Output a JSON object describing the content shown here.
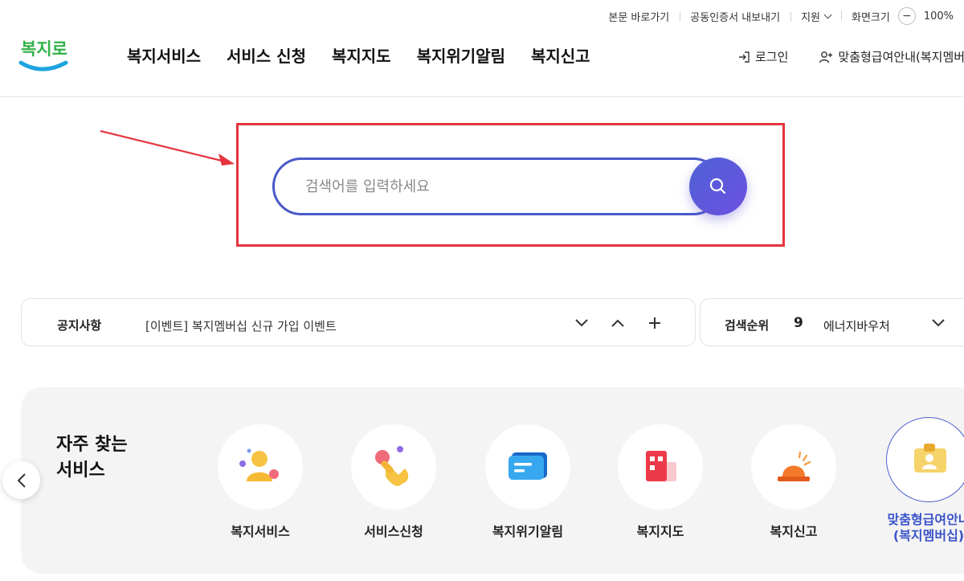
{
  "utility_bar": {
    "skip_to_content": "본문 바로가기",
    "certificate_export": "공동인증서 내보내기",
    "support": "지원",
    "zoom_label": "화면크기",
    "zoom_minus": "−",
    "zoom_value": "100%"
  },
  "logo": {
    "text": "복지로"
  },
  "nav": {
    "items": [
      "복지서비스",
      "서비스 신청",
      "복지지도",
      "복지위기알림",
      "복지신고"
    ]
  },
  "header_right": {
    "login": "로그인",
    "membership": "맞춤형급여안내(복지멤버십)"
  },
  "search": {
    "placeholder": "검색어를 입력하세요",
    "value": ""
  },
  "notice": {
    "label": "공지사항",
    "text": "[이벤트] 복지멤버십 신규 가입 이벤트"
  },
  "ranking": {
    "label": "검색순위",
    "rank": "9",
    "keyword": "에너지바우처"
  },
  "frequent": {
    "title": "자주 찾는\n서비스",
    "items": [
      {
        "name": "복지서비스",
        "icon": "person-icon"
      },
      {
        "name": "서비스신청",
        "icon": "hand-tap-icon"
      },
      {
        "name": "복지위기알림",
        "icon": "message-icon"
      },
      {
        "name": "복지지도",
        "icon": "map-building-icon"
      },
      {
        "name": "복지신고",
        "icon": "siren-icon"
      }
    ],
    "active": {
      "name_line1": "맞춤형급여안내",
      "name_line2": "(복지멤버십)",
      "icon": "id-card-icon"
    }
  },
  "colors": {
    "accent": "#4a58c9",
    "highlight": "#e5343c",
    "logo_blue": "#1fa3df",
    "logo_green": "#34b24a"
  }
}
